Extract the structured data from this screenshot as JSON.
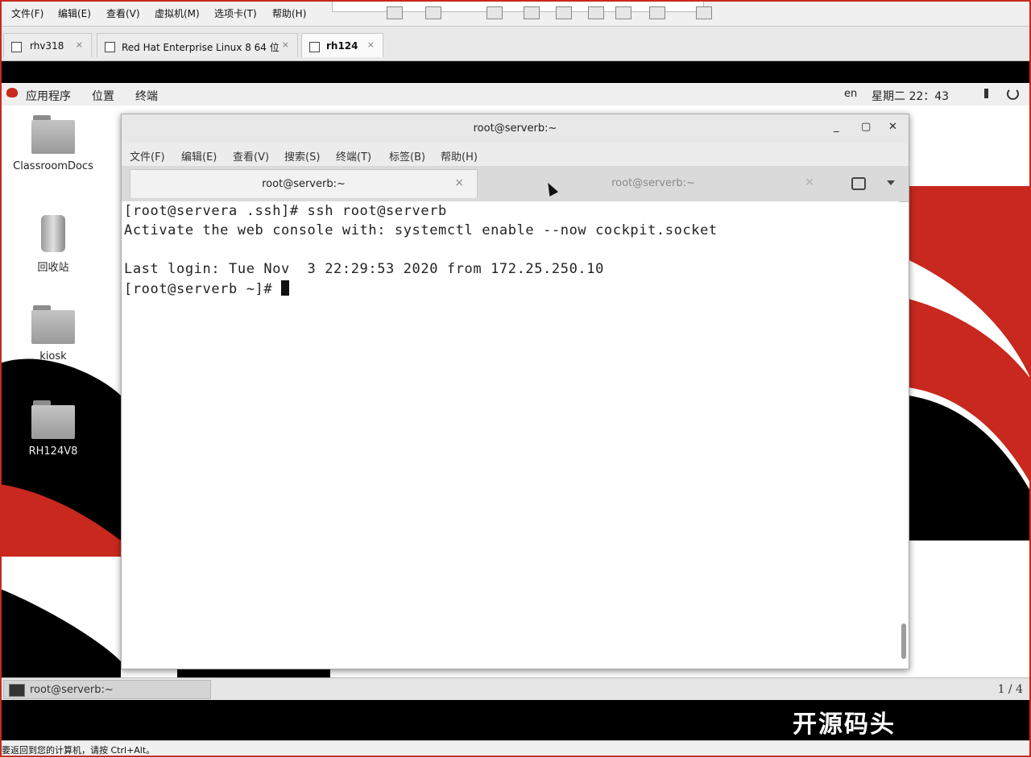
{
  "vmware": {
    "menu": [
      "文件(F)",
      "编辑(E)",
      "查看(V)",
      "虚拟机(M)",
      "选项卡(T)",
      "帮助(H)"
    ],
    "tabs": [
      {
        "label": "rhv318",
        "active": false
      },
      {
        "label": "Red Hat Enterprise Linux 8 64 位",
        "active": false
      },
      {
        "label": "rh124",
        "active": true
      }
    ],
    "tab_close_glyph": "×",
    "status_text": "要返回到您的计算机，请按 Ctrl+Alt。"
  },
  "gnome": {
    "topbar": {
      "applications": "应用程序",
      "places": "位置",
      "terminal": "终端",
      "input_method": "en",
      "clock": "星期二 22：43",
      "volume_icon": "volume-icon",
      "power_icon": "power-icon"
    },
    "desktop_icons": [
      {
        "label": "ClassroomDocs",
        "icon": "folder-icon"
      },
      {
        "label": "回收站",
        "icon": "trash-icon"
      },
      {
        "label": "kiosk",
        "icon": "home-folder-icon"
      },
      {
        "label": "RH124V8",
        "icon": "folder-icon"
      }
    ],
    "taskbar": {
      "window_label": "root@serverb:~",
      "workspace": "1 / 4"
    }
  },
  "terminal": {
    "title": "root@serverb:~",
    "window_buttons": [
      "_",
      "▢",
      "✕"
    ],
    "menu": [
      "文件(F)",
      "编辑(E)",
      "查看(V)",
      "搜索(S)",
      "终端(T)",
      "标签(B)",
      "帮助(H)"
    ],
    "tabs": [
      {
        "label": "root@serverb:~",
        "active": true
      },
      {
        "label": "root@serverb:~",
        "active": false
      }
    ],
    "lines": [
      "[root@servera .ssh]# ssh root@serverb",
      "Activate the web console with: systemctl enable --now cockpit.socket",
      "",
      "Last login: Tue Nov  3 22:29:53 2020 from 172.25.250.10",
      "[root@serverb ~]# "
    ]
  },
  "watermark": "开源码头",
  "colors": {
    "brand_red": "#c8281e",
    "terminal_bg": "#ffffff"
  }
}
